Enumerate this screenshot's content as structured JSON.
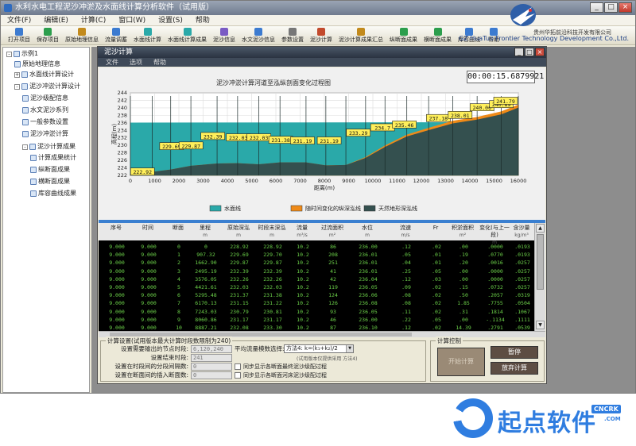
{
  "app": {
    "title": "水利水电工程泥沙冲淤及水面线计算分析软件（试用版）",
    "window_controls": [
      "_",
      "□",
      "×"
    ]
  },
  "menu": [
    "文件(F)",
    "编辑(E)",
    "计算(C)",
    "窗口(W)",
    "设置(S)",
    "帮助"
  ],
  "toolbar": [
    "打开项目",
    "保存项目",
    "原始地理信息",
    "流量调蓄",
    "水面线计算",
    "水面线计算成果",
    "泥沙信息",
    "水文泥沙信息",
    "参数设置",
    "泥沙计算",
    "泥沙计算成果汇总",
    "纵断面成果",
    "横断面成果",
    "库容曲线",
    "帮助"
  ],
  "company": {
    "cn": "贵州华拓前沿科技开发有限公司",
    "en": "GZ HuaTuo Frontier Technology Development Co.,Ltd."
  },
  "tree": [
    {
      "label": "示例1",
      "level": 0,
      "toggle": "-"
    },
    {
      "label": "原始地理信息",
      "level": 1,
      "toggle": ""
    },
    {
      "label": "水面线计算设计",
      "level": 1,
      "toggle": "+"
    },
    {
      "label": "泥沙冲淤计算设计",
      "level": 1,
      "toggle": "-"
    },
    {
      "label": "泥沙级配信息",
      "level": 2,
      "toggle": ""
    },
    {
      "label": "水文泥沙系列",
      "level": 2,
      "toggle": ""
    },
    {
      "label": "一般参数设置",
      "level": 2,
      "toggle": ""
    },
    {
      "label": "泥沙冲淤计算",
      "level": 2,
      "toggle": ""
    },
    {
      "label": "泥沙计算成果",
      "level": 2,
      "toggle": "-"
    },
    {
      "label": "计算成果统计",
      "level": 3,
      "toggle": ""
    },
    {
      "label": "纵断面成果",
      "level": 3,
      "toggle": ""
    },
    {
      "label": "横断面成果",
      "level": 3,
      "toggle": ""
    },
    {
      "label": "库容曲线成果",
      "level": 3,
      "toggle": ""
    }
  ],
  "child_window": {
    "title": "泥沙计算",
    "menu": [
      "文件",
      "选项",
      "帮助"
    ],
    "timer": "00:00:15.6879921"
  },
  "chart_data": {
    "type": "area",
    "title": "泥沙冲淤计算河道至泓纵剖面变化过程图",
    "xlabel": "距离(m)",
    "ylabel": "高程(m)",
    "xlim": [
      0,
      16000
    ],
    "ylim": [
      222,
      244
    ],
    "x_ticks": [
      0,
      1000,
      2000,
      3000,
      4000,
      5000,
      6000,
      7000,
      8000,
      9000,
      10000,
      11000,
      12000,
      13000,
      14000,
      15000,
      16000
    ],
    "y_ticks": [
      222,
      224,
      226,
      228,
      230,
      232,
      234,
      236,
      238,
      240,
      242,
      244
    ],
    "grid": true,
    "legend": "bottom",
    "series": [
      {
        "name": "水面线",
        "color": "#2aa9a9",
        "x": [
          0,
          16000
        ],
        "y": [
          236.0,
          236.1
        ]
      },
      {
        "name": "随时间变化的纵深泓线",
        "color": "#ef8a18",
        "x": [
          0,
          907,
          1663,
          2495,
          3576,
          4422,
          5295,
          6170,
          7243,
          8061,
          8887,
          9700,
          10500,
          11400,
          12300,
          13300,
          14300,
          15300,
          16000
        ],
        "y": [
          222.2,
          222.9,
          223.5,
          224.5,
          225.1,
          225.2,
          224.9,
          225.4,
          225.4,
          224.6,
          224.7,
          226.8,
          229.9,
          232.8,
          234.6,
          236.5,
          237.5,
          239.0,
          240.8
        ],
        "labels": [
          {
            "x": 500,
            "y": 222.92,
            "text": "222.92"
          },
          {
            "x": 1700,
            "y": 229.69,
            "text": "229.69"
          },
          {
            "x": 2500,
            "y": 229.87,
            "text": "229.87"
          },
          {
            "x": 3400,
            "y": 232.39,
            "text": "232.39"
          },
          {
            "x": 4450,
            "y": 232.03,
            "text": "232.03"
          },
          {
            "x": 5300,
            "y": 232.03,
            "text": "232.03"
          },
          {
            "x": 6200,
            "y": 231.38,
            "text": "231.38"
          },
          {
            "x": 7100,
            "y": 231.19,
            "text": "231.19"
          },
          {
            "x": 8200,
            "y": 231.19,
            "text": "231.19"
          },
          {
            "x": 9400,
            "y": 233.29,
            "text": "233.29"
          },
          {
            "x": 10400,
            "y": 234.7,
            "text": "234.7"
          },
          {
            "x": 11300,
            "y": 235.46,
            "text": "235.46"
          },
          {
            "x": 12700,
            "y": 237.18,
            "text": "237.18"
          },
          {
            "x": 13600,
            "y": 238.01,
            "text": "238.01"
          },
          {
            "x": 14500,
            "y": 240.06,
            "text": "240.06"
          },
          {
            "x": 15300,
            "y": 240.89,
            "text": "240.89"
          },
          {
            "x": 16000,
            "y": 241.79,
            "text": "241.79"
          }
        ]
      },
      {
        "name": "天然地形深泓线",
        "color": "#34504f",
        "x": [
          0,
          907,
          1663,
          2495,
          3576,
          4422,
          5295,
          6170,
          7243,
          8061,
          8887,
          9700,
          10500,
          11400,
          12300,
          13300,
          14300,
          15300,
          16000
        ],
        "y": [
          222.2,
          222.9,
          223.5,
          224.5,
          225.1,
          225.2,
          224.9,
          225.4,
          225.4,
          224.6,
          224.7,
          226.6,
          229.5,
          232.3,
          234.0,
          235.8,
          236.8,
          238.2,
          240.0
        ]
      }
    ]
  },
  "table": {
    "headers": [
      {
        "label": "序号",
        "unit": ""
      },
      {
        "label": "时间",
        "unit": ""
      },
      {
        "label": "断面",
        "unit": ""
      },
      {
        "label": "里程",
        "unit": "m"
      },
      {
        "label": "原始深泓",
        "unit": "m"
      },
      {
        "label": "时段末深泓",
        "unit": "m"
      },
      {
        "label": "流量",
        "unit": "m³/s"
      },
      {
        "label": "过流面积",
        "unit": "m²"
      },
      {
        "label": "水位",
        "unit": "m"
      },
      {
        "label": "流速",
        "unit": "m/s"
      },
      {
        "label": "Fr",
        "unit": ""
      },
      {
        "label": "积淤面积",
        "unit": "m²"
      },
      {
        "label": "变化(与上一段)",
        "unit": "m"
      },
      {
        "label": "含沙量",
        "unit": "kg/m³"
      }
    ],
    "rows": [
      [
        "9.000",
        "9.000",
        "0",
        "0",
        "228.92",
        "228.92",
        "10.2",
        "86",
        "236.00",
        ".12",
        ".02",
        ".00",
        ".0000",
        ".0193"
      ],
      [
        "9.000",
        "9.000",
        "1",
        "907.32",
        "229.69",
        "229.70",
        "10.2",
        "208",
        "236.01",
        ".05",
        ".01",
        ".19",
        ".0770",
        ".0193"
      ],
      [
        "9.000",
        "9.000",
        "2",
        "1662.90",
        "229.87",
        "229.87",
        "10.2",
        "251",
        "236.01",
        ".04",
        ".01",
        ".20",
        ".0016",
        ".0257"
      ],
      [
        "9.000",
        "9.000",
        "3",
        "2495.19",
        "232.39",
        "232.39",
        "10.2",
        "41",
        "236.01",
        ".25",
        ".05",
        ".00",
        ".0000",
        ".0257"
      ],
      [
        "9.000",
        "9.000",
        "4",
        "3576.05",
        "232.26",
        "232.26",
        "10.2",
        "42",
        "236.04",
        ".12",
        ".03",
        ".00",
        ".0000",
        ".0257"
      ],
      [
        "9.000",
        "9.000",
        "5",
        "4421.61",
        "232.03",
        "232.03",
        "10.2",
        "119",
        "236.05",
        ".09",
        ".02",
        ".15",
        ".0732",
        ".0257"
      ],
      [
        "9.000",
        "9.000",
        "6",
        "5295.48",
        "231.37",
        "231.38",
        "10.2",
        "124",
        "236.06",
        ".08",
        ".02",
        ".50",
        ".2057",
        ".0319"
      ],
      [
        "9.000",
        "9.000",
        "7",
        "6170.13",
        "231.15",
        "231.22",
        "10.2",
        "126",
        "236.08",
        ".08",
        ".02",
        "1.85",
        ".7755",
        ".0504"
      ],
      [
        "9.000",
        "9.000",
        "8",
        "7243.03",
        "230.79",
        "230.81",
        "10.2",
        "93",
        "236.05",
        ".11",
        ".02",
        ".31",
        ".1814",
        ".1067"
      ],
      [
        "9.000",
        "9.000",
        "9",
        "8060.86",
        "231.17",
        "231.17",
        "10.2",
        "46",
        "236.00",
        ".22",
        ".05",
        ".00",
        "-.1134",
        ".1111"
      ],
      [
        "9.000",
        "9.000",
        "10",
        "8887.21",
        "232.08",
        "233.30",
        "10.2",
        "87",
        "236.10",
        ".12",
        ".02",
        "14.39",
        ".2791",
        ".0539"
      ]
    ]
  },
  "settings": {
    "group_title": "计算设置(试用版本最大计算时段数限制为240)",
    "fields": [
      {
        "label": "设置需要输出的节点时段:",
        "value": "6,120,240"
      },
      {
        "label": "设置结束时段:",
        "value": "241"
      },
      {
        "label": "设置在时段间的分段间隔数:",
        "value": "0"
      },
      {
        "label": "设置在断面间的插入断面数:",
        "value": "0"
      }
    ],
    "avg_flow_label": "平均流量模数选择:",
    "avg_flow_value": "方法4: k=(k₁+k₂)/2",
    "avg_flow_note": "(试用版本仅提供采用 方法4)",
    "checkboxes": [
      "同步显示各断面最终泥沙级配过程",
      "同步显示各断面河床泥沙级配过程"
    ]
  },
  "calc_control": {
    "title": "计算控制",
    "start": "开始计算",
    "pause": "暂停",
    "abort": "放弃计算"
  },
  "watermark": {
    "cn": "起点软件",
    "badge": "CNCRK",
    "domain": ".COM"
  }
}
